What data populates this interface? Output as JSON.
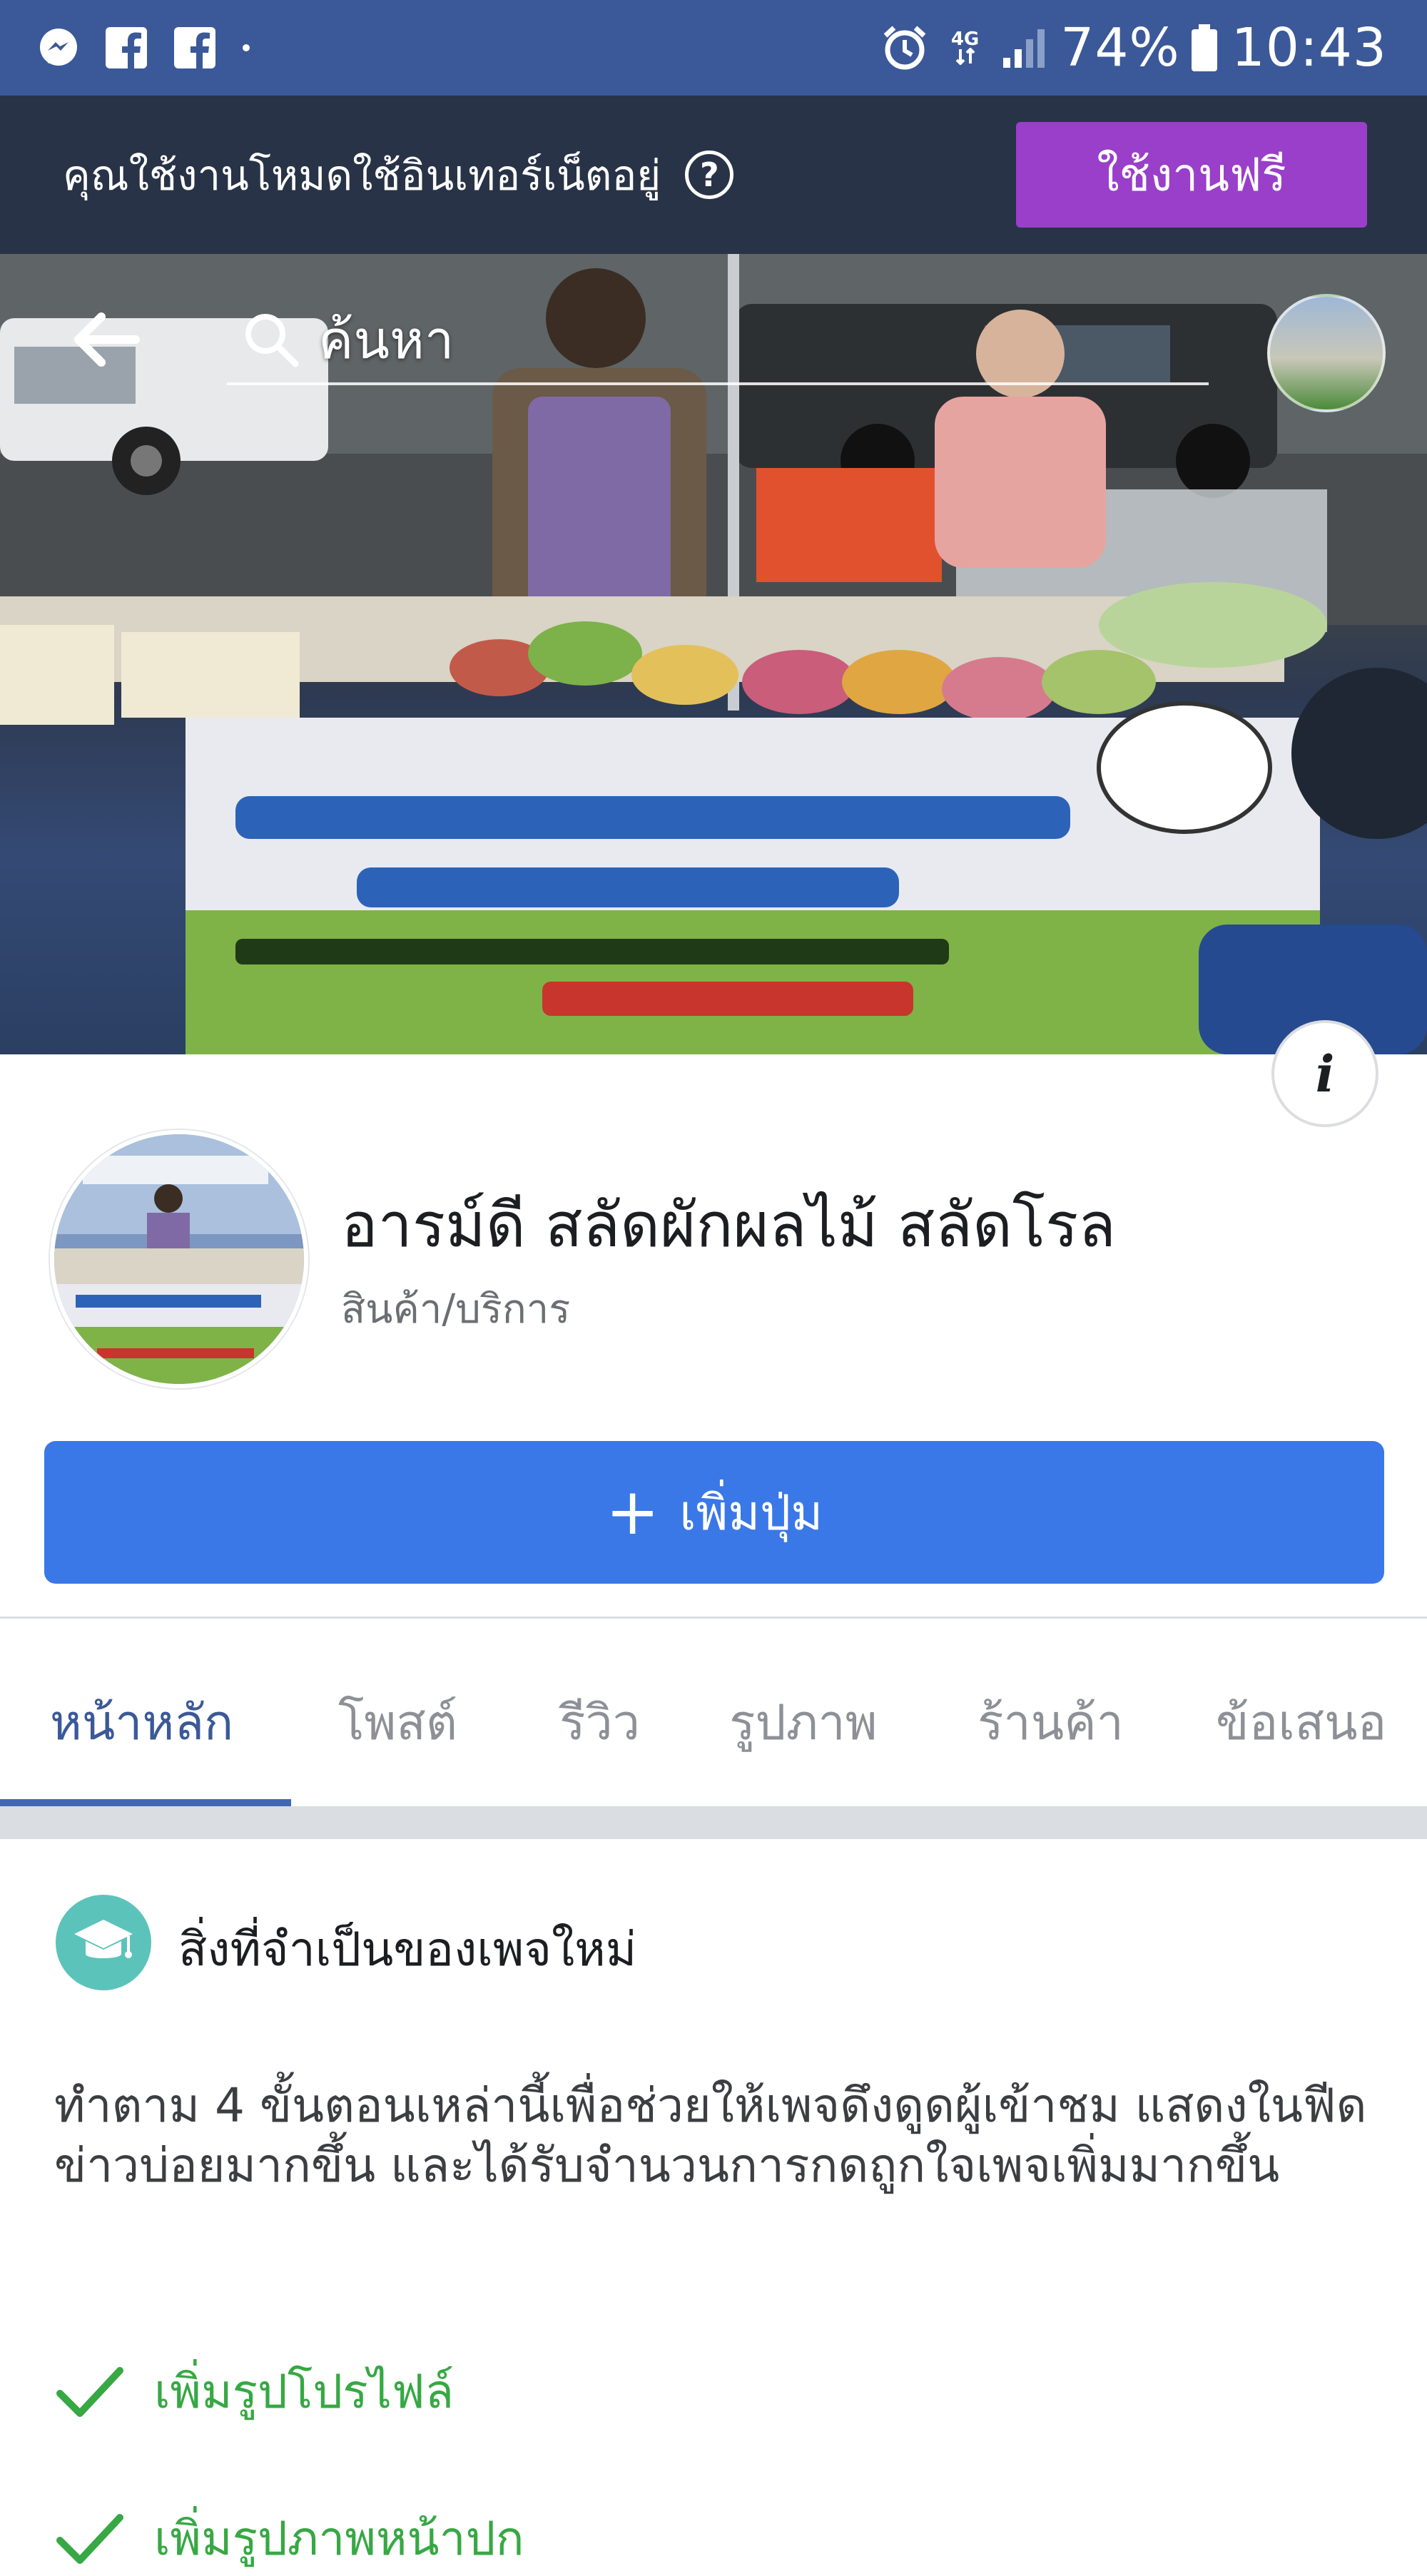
{
  "status_bar": {
    "icons_left": [
      "messenger-icon",
      "facebook-icon",
      "facebook-icon",
      "dot-icon"
    ],
    "network": "4G",
    "battery": "74%",
    "time": "10:43"
  },
  "free_mode_banner": {
    "text": "คุณใช้งานโหมดใช้อินเทอร์เน็ตอยู่",
    "help_icon": "?",
    "button_label": "ใช้งานฟรี"
  },
  "cover": {
    "search_placeholder": "ค้นหา",
    "info_icon": "i"
  },
  "profile": {
    "name": "อารม์ดี สลัดผักผลไม้ สลัดโรล",
    "category": "สินค้า/บริการ"
  },
  "add_button": {
    "plus": "+",
    "label": "เพิ่มปุ่ม"
  },
  "tabs": [
    {
      "label": "หน้าหลัก",
      "active": true
    },
    {
      "label": "โพสต์",
      "active": false
    },
    {
      "label": "รีวิว",
      "active": false
    },
    {
      "label": "รูปภาพ",
      "active": false
    },
    {
      "label": "ร้านค้า",
      "active": false
    },
    {
      "label": "ข้อเสนอ",
      "active": false
    }
  ],
  "essentials": {
    "title": "สิ่งที่จำเป็นของเพจใหม่",
    "description": "ทำตาม 4 ขั้นตอนเหล่านี้เพื่อช่วยให้เพจดึงดูดผู้เข้าชม แสดงในฟีดข่าวบ่อยมากขึ้น และได้รับจำนวนการกดถูกใจเพจเพิ่มมากขึ้น",
    "steps": [
      {
        "label": "เพิ่มรูปโปรไฟล์",
        "done": true
      },
      {
        "label": "เพิ่มรูปภาพหน้าปก",
        "done": true
      }
    ]
  },
  "colors": {
    "status_bar": "#3b5998",
    "banner": "#283347",
    "free_button": "#9a3fc9",
    "primary_button": "#3a78e8",
    "active_tab": "#3b5998",
    "check_green": "#37a844",
    "teal_icon": "#5cc3bb"
  }
}
